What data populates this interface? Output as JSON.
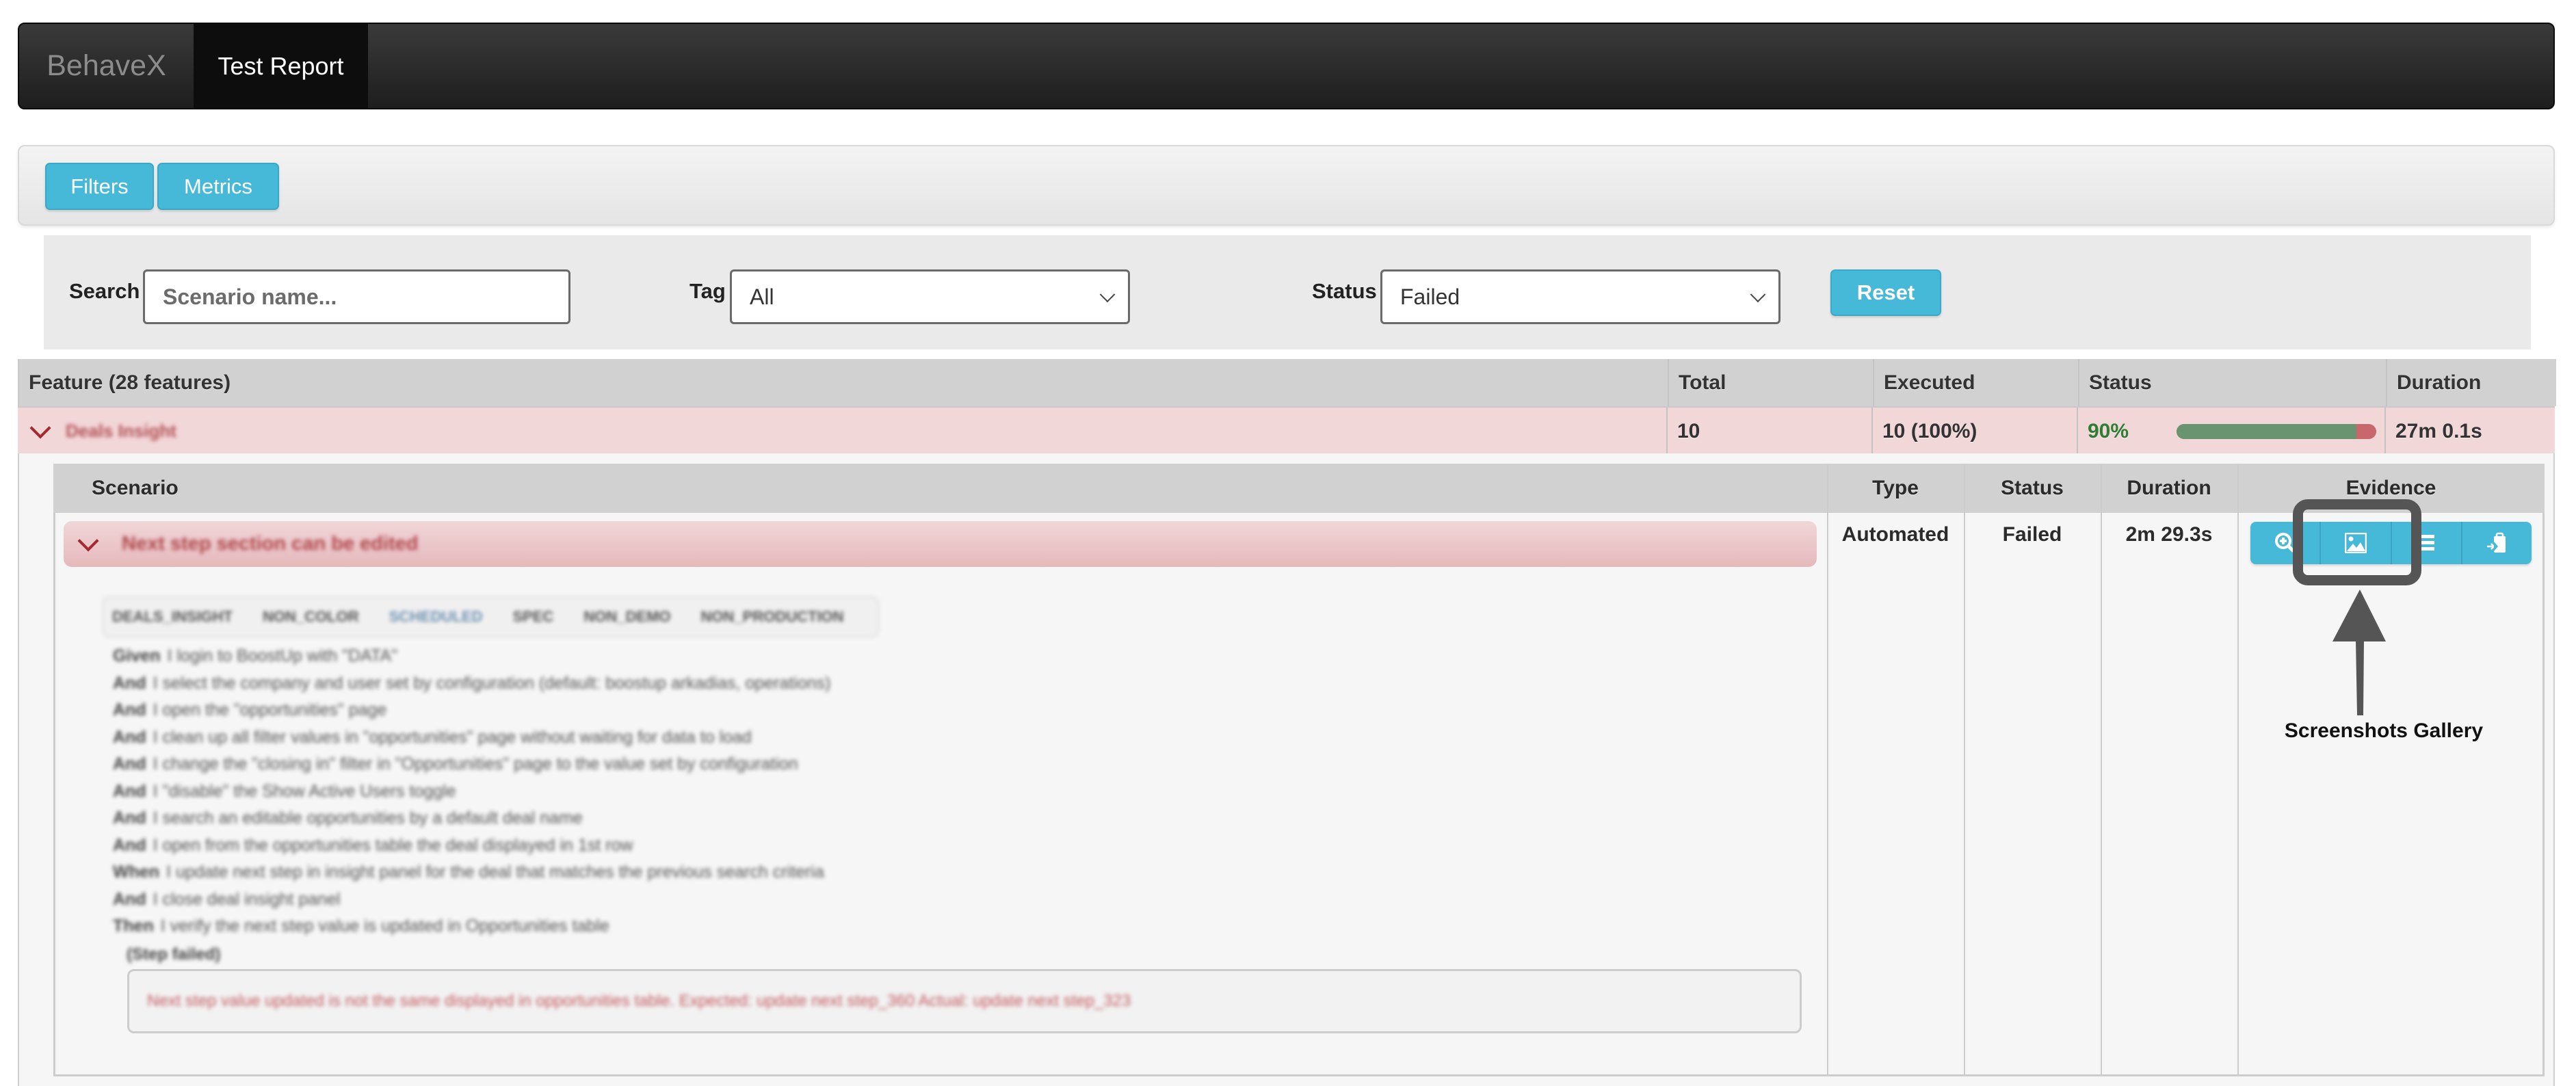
{
  "navbar": {
    "brand": "BehaveX",
    "active_tab": "Test Report"
  },
  "toolbar": {
    "filters_label": "Filters",
    "metrics_label": "Metrics"
  },
  "filters": {
    "search_label": "Search",
    "search_placeholder": "Scenario name...",
    "search_value": "",
    "tag_label": "Tag",
    "tag_selected": "All",
    "status_label": "Status",
    "status_selected": "Failed",
    "reset_label": "Reset"
  },
  "feature_table": {
    "headers": {
      "feature": "Feature (28 features)",
      "total": "Total",
      "executed": "Executed",
      "status": "Status",
      "duration": "Duration"
    },
    "rows": [
      {
        "name": "Deals Insight",
        "total": "10",
        "executed": "10 (100%)",
        "pass_rate_text": "90%",
        "pass_rate": 0.9,
        "duration": "27m 0.1s",
        "expanded": true
      }
    ]
  },
  "scenario_table": {
    "headers": {
      "scenario": "Scenario",
      "type": "Type",
      "status": "Status",
      "duration": "Duration",
      "evidence": "Evidence"
    },
    "rows": [
      {
        "name": "Next step section can be edited",
        "type": "Automated",
        "status": "Failed",
        "duration": "2m 29.3s",
        "evidence_buttons": [
          {
            "icon": "zoom-in-icon",
            "label": "Details"
          },
          {
            "icon": "image-icon",
            "label": "Screenshots Gallery"
          },
          {
            "icon": "list-icon",
            "label": "Logs"
          },
          {
            "icon": "clipboard-import-icon",
            "label": "Evidence"
          }
        ],
        "tags": [
          "DEALS_INSIGHT",
          "NON_COLOR",
          "SCHEDULED",
          "SPEC",
          "NON_DEMO",
          "NON_PRODUCTION"
        ],
        "steps": [
          {
            "keyword": "Given",
            "text": "I login to BoostUp with \"DATA\""
          },
          {
            "keyword": "And",
            "text": "I select the company and user set by configuration (default: boostup arkadias, operations)"
          },
          {
            "keyword": "And",
            "text": "I open the \"opportunities\" page"
          },
          {
            "keyword": "And",
            "text": "I clean up all filter values in \"opportunities\" page without waiting for data to load"
          },
          {
            "keyword": "And",
            "text": "I change the \"closing in\" filter in \"Opportunities\" page to the value set by configuration"
          },
          {
            "keyword": "And",
            "text": "I \"disable\" the Show Active Users toggle"
          },
          {
            "keyword": "And",
            "text": "I search an editable opportunities by a default deal name"
          },
          {
            "keyword": "And",
            "text": "I open from the opportunities table the deal displayed in 1st row"
          },
          {
            "keyword": "When",
            "text": "I update next step in insight panel for the deal that matches the previous search criteria"
          },
          {
            "keyword": "And",
            "text": "I close deal insight panel"
          },
          {
            "keyword": "Then",
            "text": "I verify the next step value is updated in Opportunities table"
          }
        ],
        "step_failed_label": "(Step failed)",
        "error_message": "Next step value updated is not the same displayed in opportunities table. Expected: update next step_360 Actual: update next step_323"
      }
    ]
  },
  "annotation": {
    "label": "Screenshots Gallery",
    "target": "image-icon"
  },
  "colors": {
    "accent": "#46b8d8",
    "failed_row": "#f2d7d8",
    "pass_bar": "#6a9470",
    "fail_bar": "#c9686c",
    "pass_text": "#2e7d32",
    "annotation": "#555555"
  }
}
